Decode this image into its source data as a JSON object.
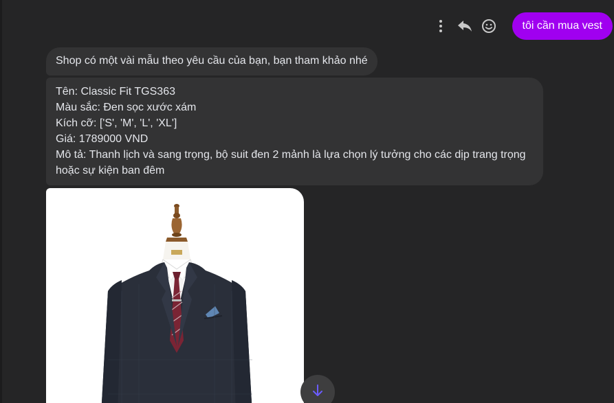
{
  "messages": {
    "sent": {
      "text": "tôi cần mua vest",
      "bubble_color": "#a000f0"
    },
    "actions": [
      {
        "icon": "more-vertical-icon"
      },
      {
        "icon": "reply-icon"
      },
      {
        "icon": "smile-icon"
      }
    ],
    "reply_intro": "Shop có một vài mẫu theo yêu cầu của bạn, bạn tham khảo nhé",
    "product": {
      "name_line": "Tên: Classic Fit TGS363",
      "color_line": "Màu sắc: Đen sọc xước xám",
      "size_line": "Kích cỡ: ['S', 'M', 'L', 'XL']",
      "price_line": "Giá: 1789000 VND",
      "description_line": "Mô tả: Thanh lịch và sang trọng, bộ suit đen 2 mảnh là lựa chọn lý tưởng cho các dịp trang trọng hoặc sự kiện ban đêm"
    },
    "product_image": {
      "icon": "suit-on-mannequin-image"
    },
    "scroll_button": {
      "icon": "arrow-down-icon",
      "accent": "#6b5cff"
    }
  },
  "theme": {
    "background": "#252526",
    "received_bubble": "#333334",
    "text": "#e4e6eb"
  }
}
